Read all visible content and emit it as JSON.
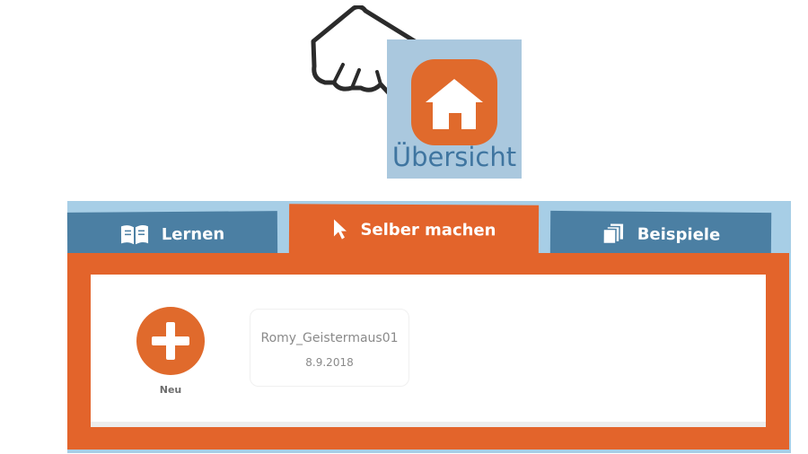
{
  "overview": {
    "label": "Übersicht",
    "icon": "home-icon",
    "pointer": "pointing-hand-icon"
  },
  "tabs": [
    {
      "label": "Lernen",
      "icon": "book-icon",
      "active": false
    },
    {
      "label": "Selber machen",
      "icon": "cursor-arrow-icon",
      "active": true
    },
    {
      "label": "Beispiele",
      "icon": "pages-stack-icon",
      "active": false
    }
  ],
  "content": {
    "new_label": "Neu",
    "projects": [
      {
        "name": "Romy_Geistermaus01",
        "date": "8.9.2018"
      }
    ]
  },
  "colors": {
    "accent_orange": "#e3642b",
    "tab_blue": "#4b7fa3",
    "overview_bg": "#aac8de",
    "overview_text": "#3f75a0"
  }
}
